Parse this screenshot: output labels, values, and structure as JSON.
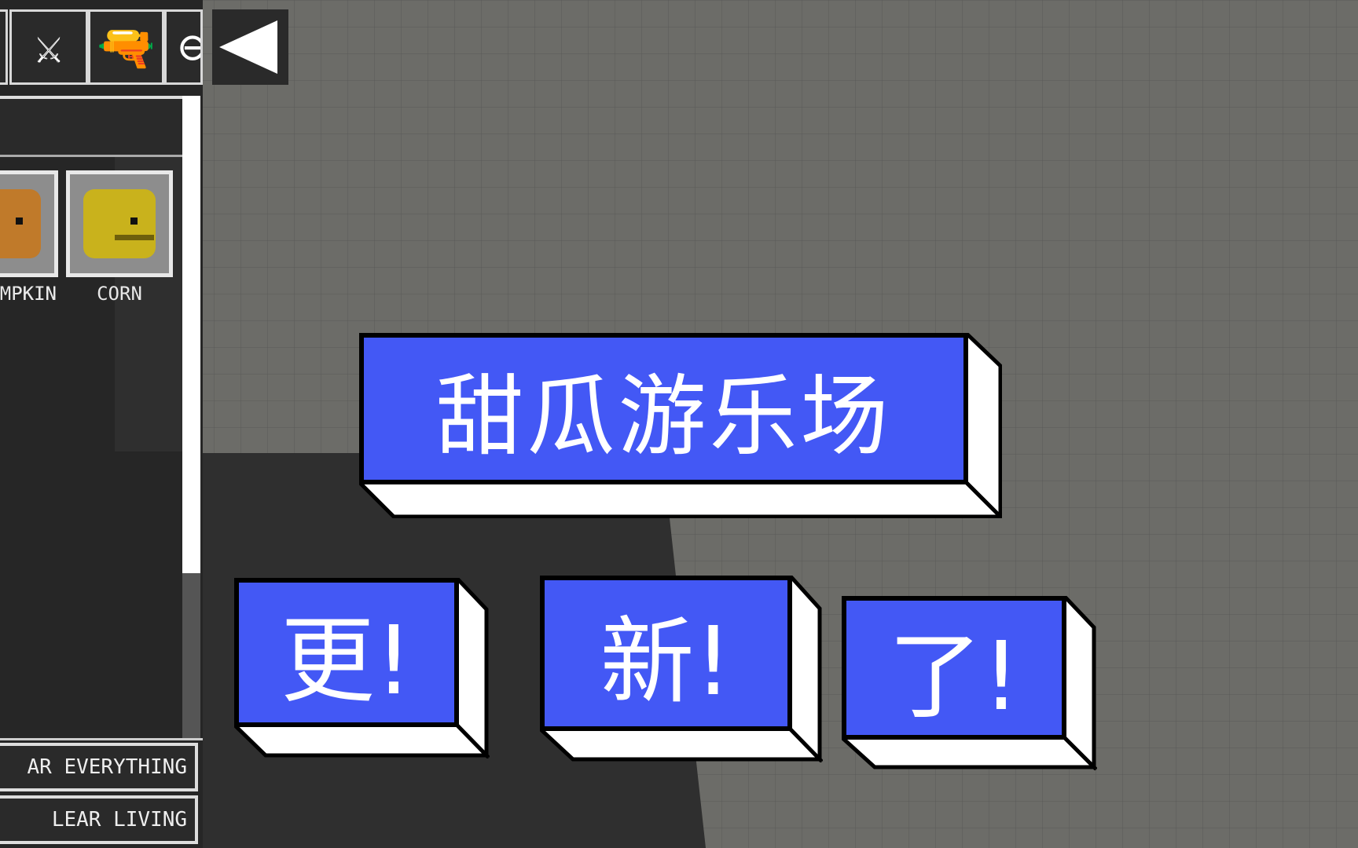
{
  "toolbar": {
    "tools": [
      {
        "icon": "sword-icon"
      },
      {
        "icon": "pistol-icon"
      },
      {
        "icon": "grenade-icon"
      }
    ],
    "back_icon": "back-triangle-icon"
  },
  "items": [
    {
      "label": "PUMPKIN",
      "visible_label": "PKIN",
      "color": "#c07a2a"
    },
    {
      "label": "CORN",
      "visible_label": "CORN",
      "color": "#c9b21c"
    }
  ],
  "buttons": {
    "clear_everything": "AR EVERYTHING",
    "clear_living": "LEAR LIVING"
  },
  "overlay": {
    "title": "甜瓜游乐场",
    "words": [
      "更!",
      "新!",
      "了!"
    ],
    "box_color": "#4358f5"
  }
}
